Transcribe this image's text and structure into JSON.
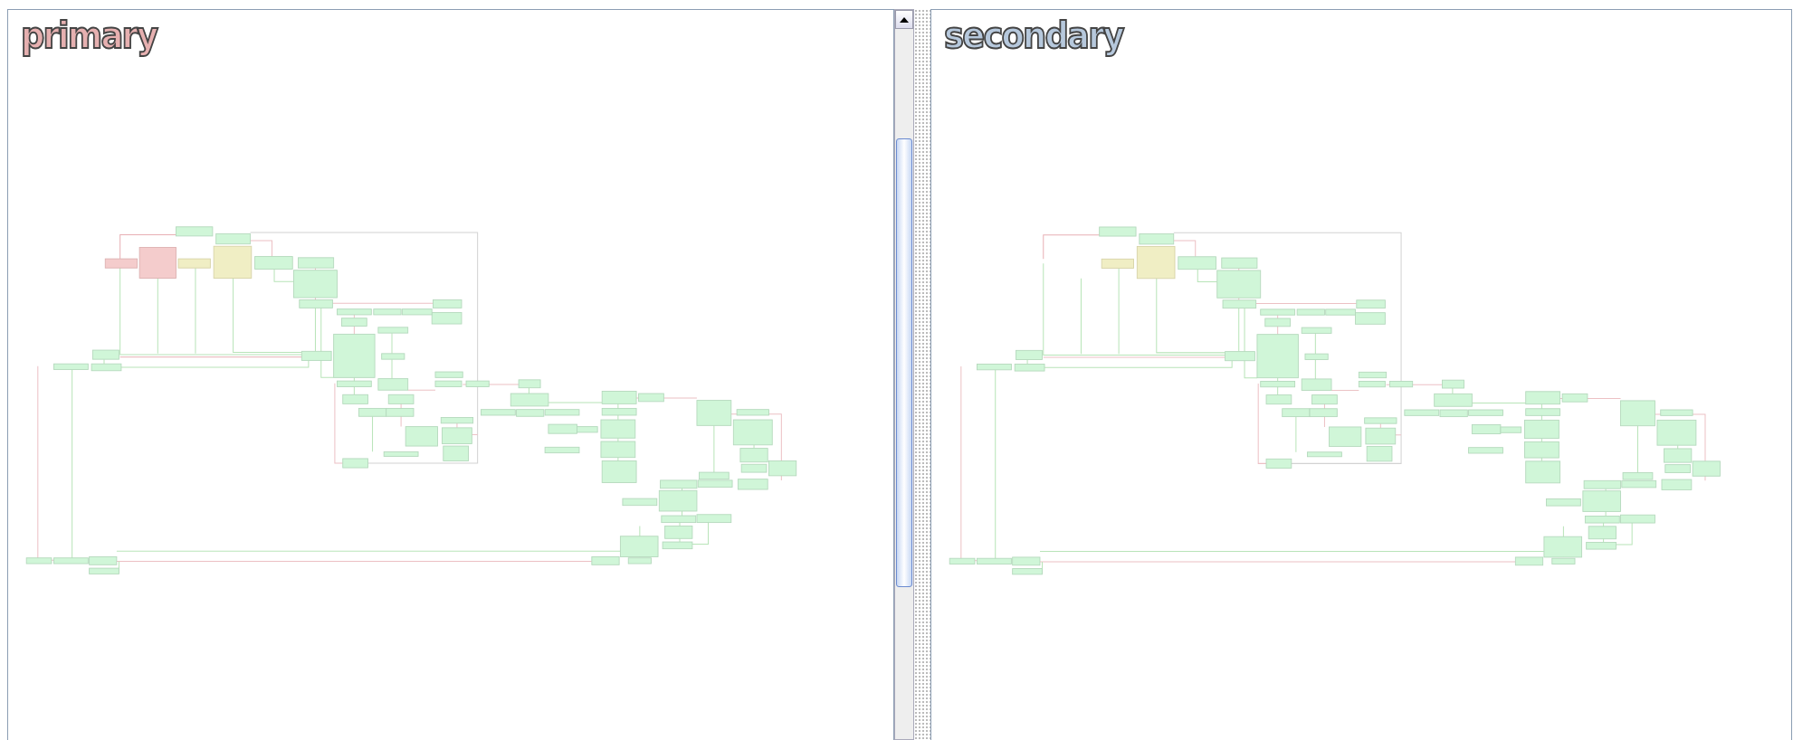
{
  "panels": [
    {
      "title": "primary",
      "color": "#e6b0b0",
      "unmatched_nodes": true,
      "scrollbar": true
    },
    {
      "title": "secondary",
      "color": "#b6c8dc",
      "unmatched_nodes": false,
      "scrollbar": false
    }
  ]
}
